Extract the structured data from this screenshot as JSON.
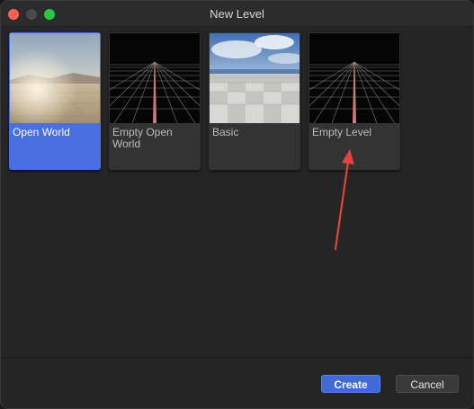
{
  "window": {
    "title": "New Level"
  },
  "templates": [
    {
      "label": "Open World",
      "thumbnail": "desert-sky-landscape",
      "selected": true
    },
    {
      "label": "Empty Open World",
      "thumbnail": "grid-perspective",
      "selected": false
    },
    {
      "label": "Basic",
      "thumbnail": "tiled-floor-sky",
      "selected": false
    },
    {
      "label": "Empty Level",
      "thumbnail": "grid-perspective",
      "selected": false
    }
  ],
  "buttons": {
    "create": "Create",
    "cancel": "Cancel"
  },
  "annotation": {
    "icon": "red-arrow",
    "color": "#e0443c"
  },
  "colors": {
    "accent": "#4a6fe3",
    "create_button": "#3f6ad8"
  }
}
